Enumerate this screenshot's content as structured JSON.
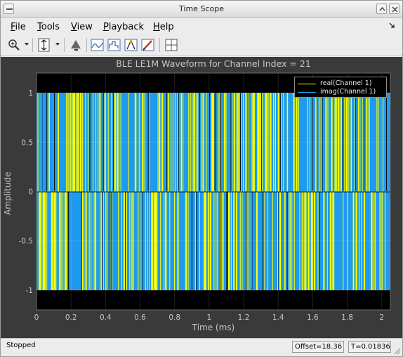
{
  "window": {
    "title": "Time Scope"
  },
  "menu": {
    "file": {
      "mnemonic": "F",
      "rest": "ile"
    },
    "tools": {
      "mnemonic": "T",
      "rest": "ools"
    },
    "view": {
      "mnemonic": "V",
      "rest": "iew"
    },
    "playback": {
      "mnemonic": "P",
      "rest": "layback"
    },
    "help": {
      "mnemonic": "H",
      "rest": "elp"
    }
  },
  "toolbar": {
    "icons": [
      "zoom-in-icon",
      "scale-axes-icon",
      "style-icon",
      "cursor-measurements-icon",
      "signal-statistics-icon",
      "peak-finder-icon",
      "bilevel-measurements-icon",
      "layout-icon"
    ]
  },
  "chart_data": {
    "type": "line",
    "title": "BLE LE1M Waveform for Channel Index = 21",
    "xlabel": "Time (ms)",
    "ylabel": "Amplitude",
    "xlim": [
      0,
      2.05
    ],
    "ylim": [
      -1.2,
      1.2
    ],
    "xticks": [
      "0",
      "0.2",
      "0.4",
      "0.6",
      "0.8",
      "1",
      "1.2",
      "1.4",
      "1.6",
      "1.8",
      "2"
    ],
    "yticks": [
      "1",
      "0.5",
      "0",
      "-0.5",
      "-1"
    ],
    "grid": true,
    "legend_position": "top-right",
    "series": [
      {
        "name": "real(Channel 1)",
        "color": "#ffff00",
        "description_values": [
          -1,
          1
        ]
      },
      {
        "name": "imag(Channel 1)",
        "color": "#1e9bf0",
        "description_values": [
          -1,
          1
        ]
      }
    ],
    "colors": {
      "background": "#000000",
      "axes_frame": "#3a3a3a",
      "grid": "#4a4a4a",
      "text": "#c6c6c6"
    }
  },
  "status": {
    "state": "Stopped",
    "offset": "Offset=18.36",
    "time": "T=0.01836"
  }
}
